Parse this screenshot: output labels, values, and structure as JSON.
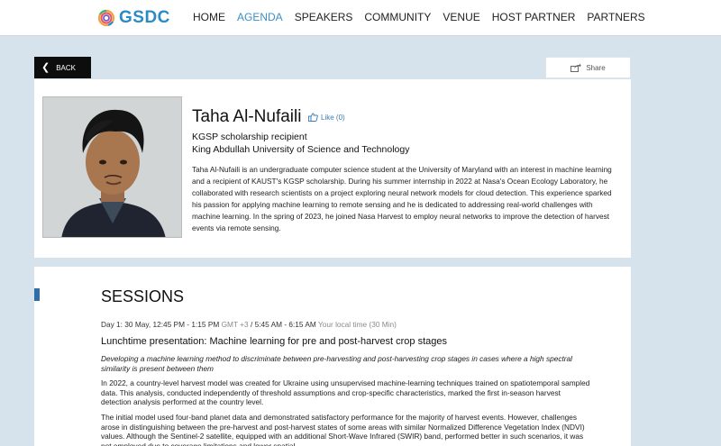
{
  "header": {
    "logo_text": "GSDC",
    "nav": [
      {
        "label": "HOME",
        "active": false
      },
      {
        "label": "AGENDA",
        "active": true
      },
      {
        "label": "SPEAKERS",
        "active": false
      },
      {
        "label": "COMMUNITY",
        "active": false
      },
      {
        "label": "VENUE",
        "active": false
      },
      {
        "label": "HOST PARTNER",
        "active": false
      },
      {
        "label": "PARTNERS",
        "active": false
      }
    ],
    "accent_color": "#3a8fc6"
  },
  "actions": {
    "back_label": "BACK",
    "share_label": "Share"
  },
  "speaker": {
    "name": "Taha Al-Nufaili",
    "like_label": "Like (0)",
    "role": "KGSP scholarship recipient",
    "organization": "King Abdullah University of Science and Technology",
    "bio": "Taha Al-Nufaili is an undergraduate computer science student at the University of Maryland with an interest in machine learning and a recipient of KAUST's KGSP scholarship. During his summer internship in 2022 at Nasa's Ocean Ecology Laboratory, he collaborated with research scientists on a project exploring neural network models for cloud detection. This experience sparked his passion for applying machine learning to remote sensing and he is dedicated to addressing real-world challenges with machine learning. In the spring of 2023, he joined Nasa Harvest to employ neural networks to improve the detection of harvest events via remote sensing."
  },
  "sessions": {
    "title": "SESSIONS",
    "day": "Day 1: 30 May, 12:45 PM - 1:15 PM",
    "tz": "GMT +3",
    "local": "/ 5:45 AM - 6:15 AM",
    "local_label": "Your local time",
    "duration": "(30 Min)",
    "session_title": "Lunchtime presentation: Machine learning for pre and post-harvest crop stages",
    "subtitle": "Developing a machine learning method to discriminate between pre-harvesting and post-harvesting crop stages in cases where a high spectral similarity is present between them",
    "p1": "In 2022, a country-level harvest model was created for Ukraine using unsupervised machine-learning techniques trained on spatiotemporal sampled data. This analysis, conducted independently of threshold assumptions and crop-specific characteristics, marked the first in-season harvest detection analysis performed at the country level.",
    "p2": "The initial model used four-band planet data and demonstrated satisfactory performance for the majority of harvest events. However, challenges arose in distinguishing between the pre-harvest and post-harvest states of some areas with similar Normalized Difference Vegetation Index (NDVI) values. Although the Sentinel-2 satellite, equipped with an additional Short-Wave Infrared (SWIR) band, performed better in such scenarios, it was not employed due to coverage limitations and lower spatial"
  }
}
